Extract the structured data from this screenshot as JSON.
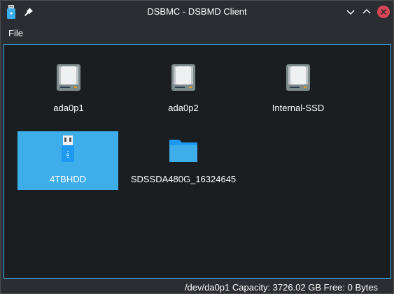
{
  "window": {
    "title": "DSBMC - DSBMD Client"
  },
  "menubar": {
    "items": [
      {
        "label": "File"
      }
    ]
  },
  "devices": [
    {
      "label": "ada0p1",
      "icon": "hard-disk-icon",
      "selected": false
    },
    {
      "label": "ada0p2",
      "icon": "hard-disk-icon",
      "selected": false
    },
    {
      "label": "Internal-SSD",
      "icon": "hard-disk-icon",
      "selected": false
    },
    {
      "label": "4TBHDD",
      "icon": "usb-drive-icon",
      "selected": true
    },
    {
      "label": "SDSSDA480G_16324645",
      "icon": "folder-icon",
      "selected": false
    }
  ],
  "status": {
    "text": "/dev/da0p1 Capacity: 3726.02 GB Free: 0 Bytes"
  },
  "colors": {
    "selection": "#3daee9",
    "close": "#da4453",
    "background": "#2a2e32",
    "view_background": "#1b1e20"
  }
}
